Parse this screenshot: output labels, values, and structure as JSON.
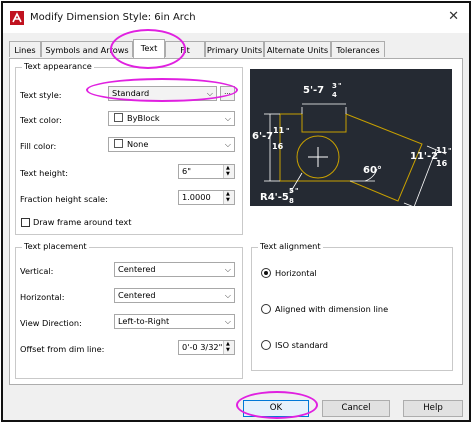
{
  "window": {
    "title": "Modify Dimension Style: 6in Arch",
    "close_glyph": "✕"
  },
  "tabs": [
    {
      "label": "Lines"
    },
    {
      "label": "Symbols and Arrows"
    },
    {
      "label": "Text"
    },
    {
      "label": "Fit"
    },
    {
      "label": "Primary Units"
    },
    {
      "label": "Alternate Units"
    },
    {
      "label": "Tolerances"
    }
  ],
  "active_tab": "Text",
  "text_appearance": {
    "title": "Text appearance",
    "text_style_label": "Text style:",
    "text_style_value": "Standard",
    "ellipsis_label": "...",
    "text_color_label": "Text color:",
    "text_color_value": "ByBlock",
    "fill_color_label": "Fill color:",
    "fill_color_value": "None",
    "text_height_label": "Text height:",
    "text_height_value": "6\"",
    "fraction_label": "Fraction height scale:",
    "fraction_value": "1.0000",
    "draw_frame_label": "Draw frame around text",
    "draw_frame_checked": false
  },
  "text_placement": {
    "title": "Text placement",
    "vertical_label": "Vertical:",
    "vertical_value": "Centered",
    "horizontal_label": "Horizontal:",
    "horizontal_value": "Centered",
    "view_dir_label": "View Direction:",
    "view_dir_value": "Left-to-Right",
    "offset_label": "Offset from dim line:",
    "offset_value": "0'-0 3/32\""
  },
  "text_alignment": {
    "title": "Text alignment",
    "options": [
      {
        "label": "Horizontal",
        "selected": true
      },
      {
        "label": "Aligned with dimension line",
        "selected": false
      },
      {
        "label": "ISO standard",
        "selected": false
      }
    ]
  },
  "preview": {
    "dim_top_main": "5'-7",
    "dim_top_num": "3",
    "dim_top_den": "4",
    "dim_top_suffix": "\"",
    "dim_left_main": "6'-7",
    "dim_left_num": "11",
    "dim_left_den": "16",
    "dim_left_suffix": "\"",
    "dim_right_main": "11'-2",
    "dim_right_num": "11",
    "dim_right_den": "16",
    "dim_right_suffix": "\"",
    "dim_angle": "60°",
    "dim_radius_main": "R4'-5",
    "dim_radius_num": "5",
    "dim_radius_den": "8",
    "dim_radius_suffix": "\"",
    "colors": {
      "background": "#252a33",
      "geometry": "#c8a000",
      "dimension": "#ffffff"
    }
  },
  "buttons": {
    "ok": "OK",
    "cancel": "Cancel",
    "help": "Help"
  },
  "highlight_color": "#e020e0"
}
